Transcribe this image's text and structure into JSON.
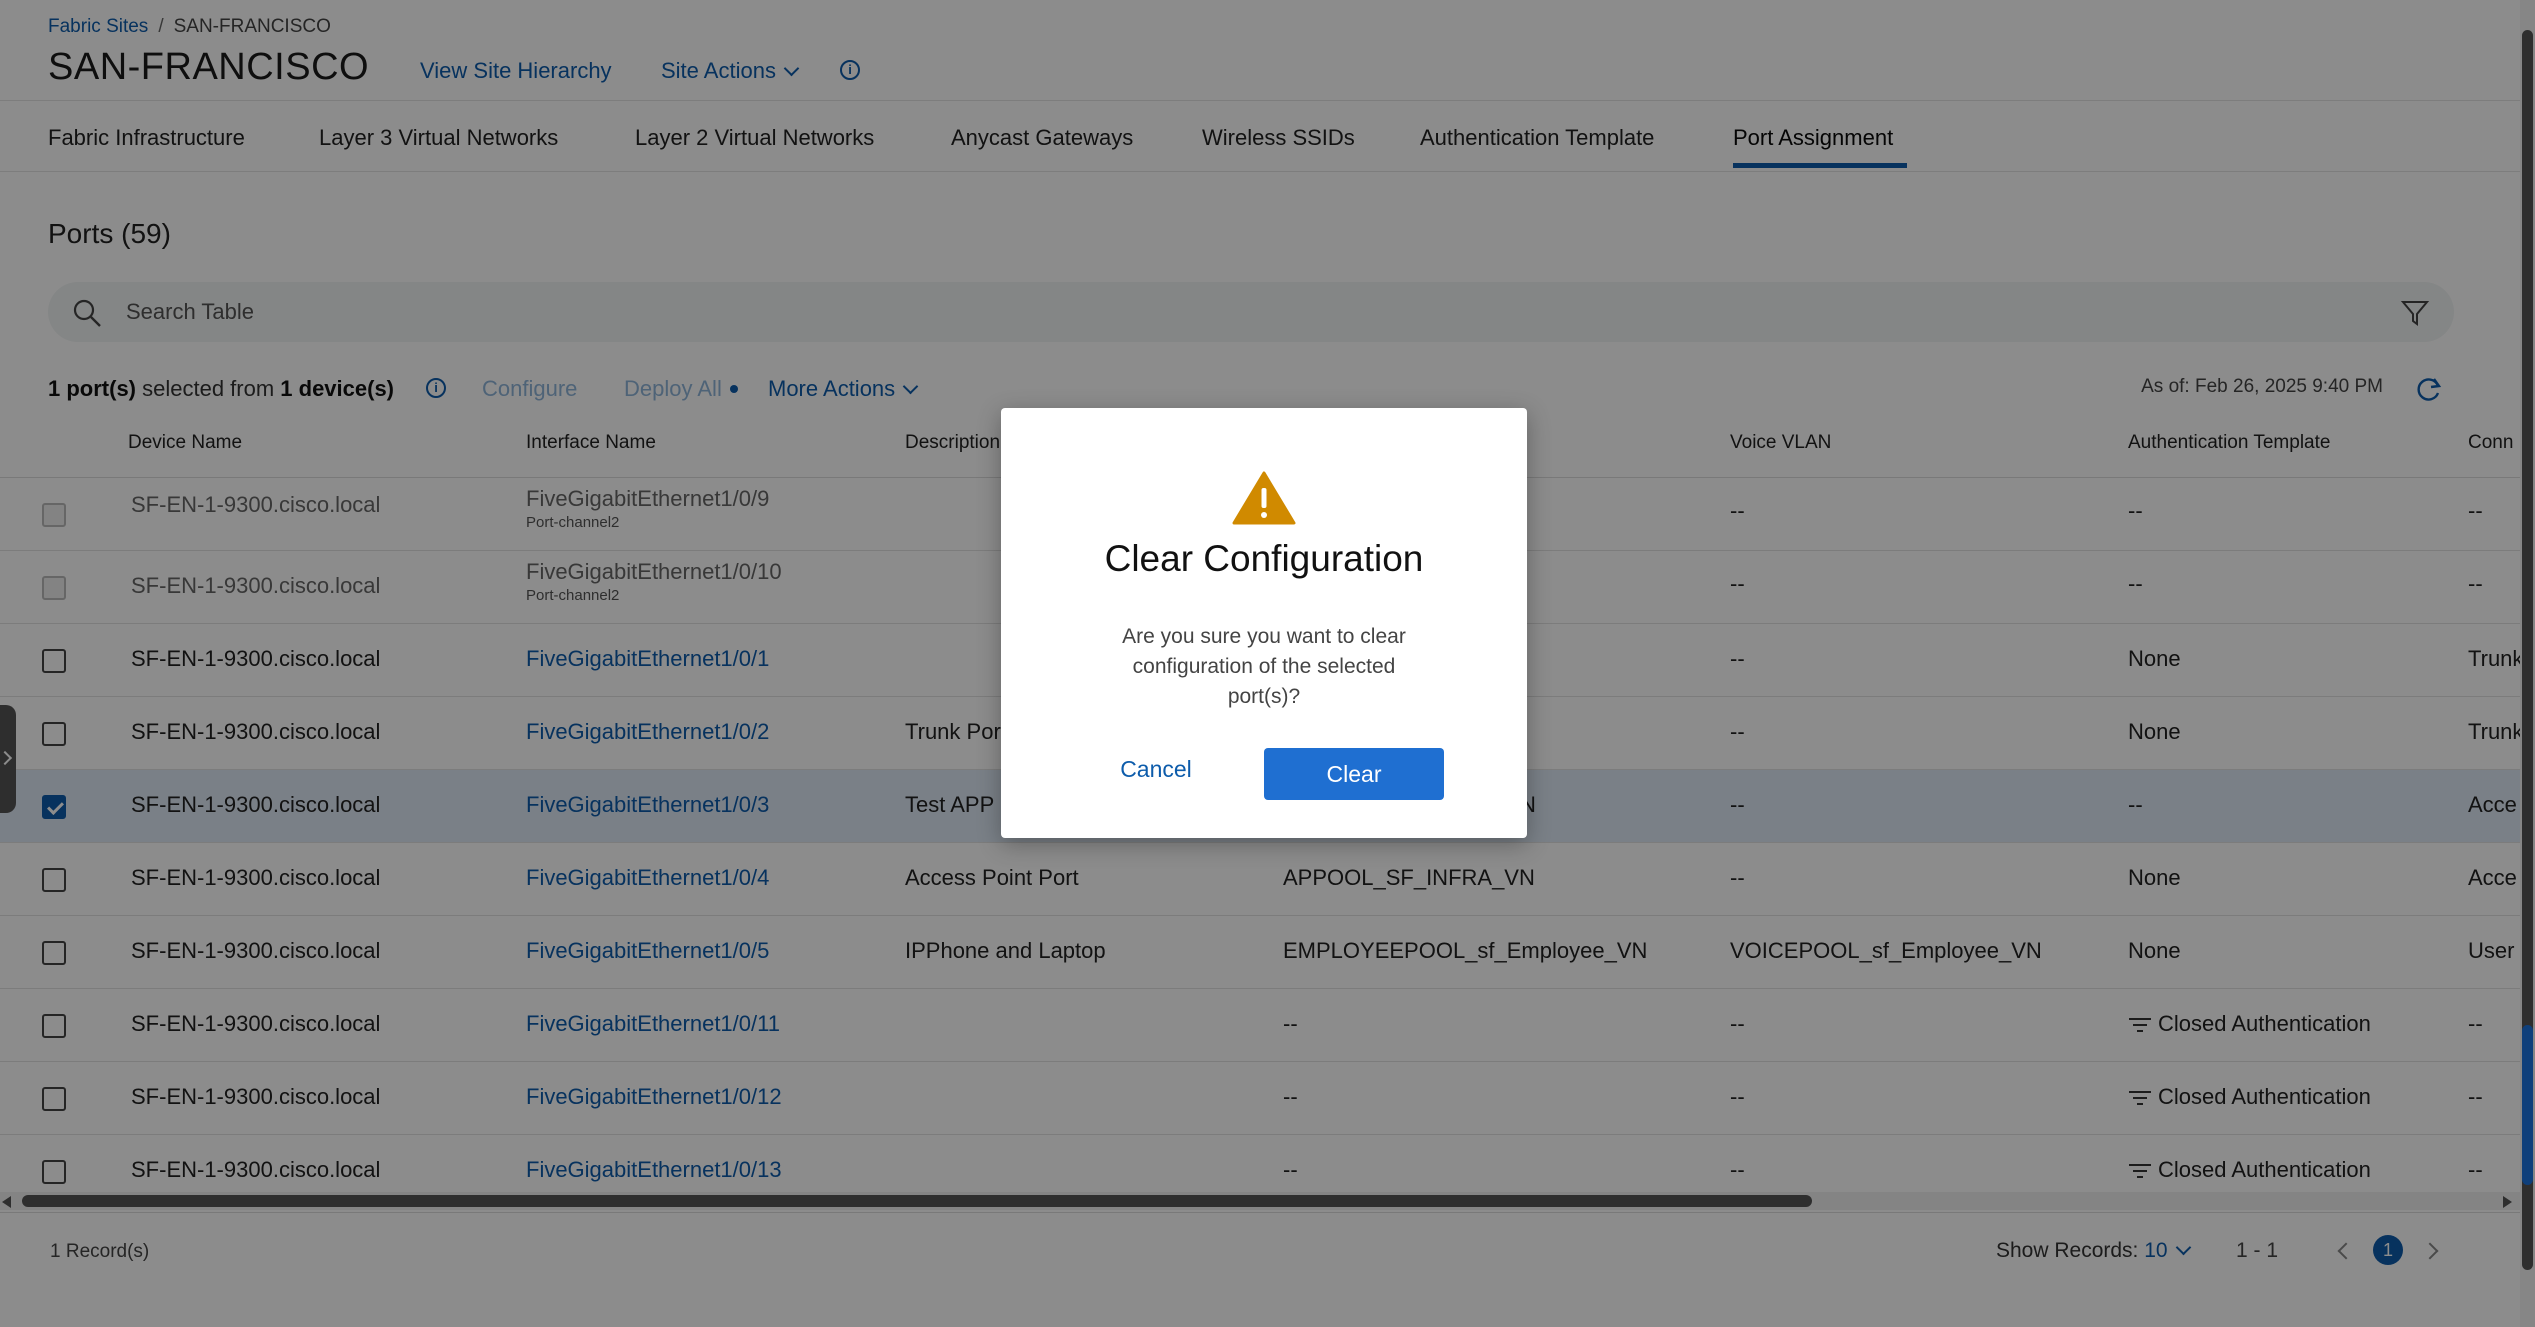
{
  "breadcrumb": {
    "parent": "Fabric Sites",
    "separator": "/",
    "current": "SAN-FRANCISCO"
  },
  "header": {
    "title": "SAN-FRANCISCO",
    "view_hierarchy": "View Site Hierarchy",
    "site_actions": "Site Actions",
    "info": "i"
  },
  "tabs": [
    "Fabric Infrastructure",
    "Layer 3 Virtual Networks",
    "Layer 2 Virtual Networks",
    "Anycast Gateways",
    "Wireless SSIDs",
    "Authentication Template",
    "Port Assignment"
  ],
  "ports": {
    "title": "Ports (59)"
  },
  "search": {
    "placeholder": "Search Table"
  },
  "toolbar": {
    "selected_count": "1 port(s)",
    "selected_mid": " selected from ",
    "device_count": "1 device(s)",
    "configure": "Configure",
    "deploy_all": "Deploy All",
    "more_actions": "More Actions",
    "as_of": "As of: Feb 26, 2025 9:40 PM"
  },
  "table": {
    "columns": [
      "Device Name",
      "Interface Name",
      "Description",
      "Voice VLAN",
      "Authentication Template",
      "Conn"
    ],
    "rows": [
      {
        "device": "SF-EN-1-9300.cisco.local",
        "iface": "FiveGigabitEthernet1/0/9",
        "sub": "Port-channel2",
        "desc": "",
        "data": "",
        "voice": "--",
        "auth": "--",
        "conn": "--"
      },
      {
        "device": "SF-EN-1-9300.cisco.local",
        "iface": "FiveGigabitEthernet1/0/10",
        "sub": "Port-channel2",
        "desc": "",
        "data": "",
        "voice": "--",
        "auth": "--",
        "conn": "--"
      },
      {
        "device": "SF-EN-1-9300.cisco.local",
        "iface": "FiveGigabitEthernet1/0/1",
        "sub": "",
        "desc": "",
        "data": "",
        "voice": "--",
        "auth": "None",
        "conn": "Trunk"
      },
      {
        "device": "SF-EN-1-9300.cisco.local",
        "iface": "FiveGigabitEthernet1/0/2",
        "sub": "",
        "desc": "Trunk Por",
        "data": "",
        "voice": "--",
        "auth": "None",
        "conn": "Trunk"
      },
      {
        "device": "SF-EN-1-9300.cisco.local",
        "iface": "FiveGigabitEthernet1/0/3",
        "sub": "",
        "desc": "Test APP",
        "data": "N",
        "voice": "--",
        "auth": "--",
        "conn": "Acce"
      },
      {
        "device": "SF-EN-1-9300.cisco.local",
        "iface": "FiveGigabitEthernet1/0/4",
        "sub": "",
        "desc": "Access Point Port",
        "data": "APPOOL_SF_INFRA_VN",
        "voice": "--",
        "auth": "None",
        "conn": "Acce"
      },
      {
        "device": "SF-EN-1-9300.cisco.local",
        "iface": "FiveGigabitEthernet1/0/5",
        "sub": "",
        "desc": "IPPhone and Laptop",
        "data": "EMPLOYEEPOOL_sf_Employee_VN",
        "voice": "VOICEPOOL_sf_Employee_VN",
        "auth": "None",
        "conn": "User"
      },
      {
        "device": "SF-EN-1-9300.cisco.local",
        "iface": "FiveGigabitEthernet1/0/11",
        "sub": "",
        "desc": "",
        "data": "--",
        "voice": "--",
        "auth": "Closed Authentication",
        "conn": "--"
      },
      {
        "device": "SF-EN-1-9300.cisco.local",
        "iface": "FiveGigabitEthernet1/0/12",
        "sub": "",
        "desc": "",
        "data": "--",
        "voice": "--",
        "auth": "Closed Authentication",
        "conn": "--"
      },
      {
        "device": "SF-EN-1-9300.cisco.local",
        "iface": "FiveGigabitEthernet1/0/13",
        "sub": "",
        "desc": "",
        "data": "--",
        "voice": "--",
        "auth": "Closed Authentication",
        "conn": "--"
      }
    ]
  },
  "footer": {
    "records": "1 Record(s)",
    "show_records_label": "Show Records: ",
    "show_records_value": "10",
    "range": "1 - 1",
    "page": "1"
  },
  "modal": {
    "title": "Clear Configuration",
    "message": "Are you sure you want to clear configuration of the selected port(s)?",
    "cancel": "Cancel",
    "confirm": "Clear"
  },
  "colors": {
    "accent": "#0d5cab",
    "primary_button": "#1f6fd1",
    "warning": "#d08a00",
    "selected_row": "#dfe9f6"
  },
  "icons": [
    "search-icon",
    "filter-icon",
    "refresh-icon",
    "info-icon",
    "warning-icon",
    "chevron-down-icon",
    "closed-auth-icon"
  ]
}
